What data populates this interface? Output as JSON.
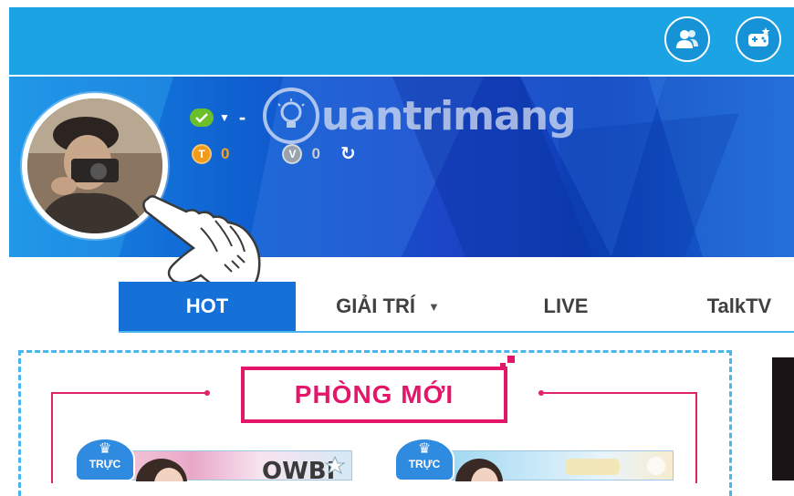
{
  "banner": {
    "watermark": "uantrimang",
    "coin_t_symbol": "T",
    "coin_t_value": "0",
    "coin_v_symbol": "V",
    "coin_v_value": "0",
    "status_dash": "-"
  },
  "nav": {
    "tabs": [
      {
        "label": "HOT",
        "active": true
      },
      {
        "label": "GIẢI TRÍ",
        "active": false
      },
      {
        "label": "LIVE",
        "active": false
      },
      {
        "label": "TalkTV",
        "active": false
      }
    ]
  },
  "section": {
    "title": "PHÒNG MỚI"
  },
  "rooms": [
    {
      "badge": "TRỰC"
    },
    {
      "badge": "TRỰC"
    }
  ],
  "colors": {
    "topbar": "#1ba3e4",
    "accent_pink": "#e3166a",
    "nav_active": "#1570d8"
  }
}
